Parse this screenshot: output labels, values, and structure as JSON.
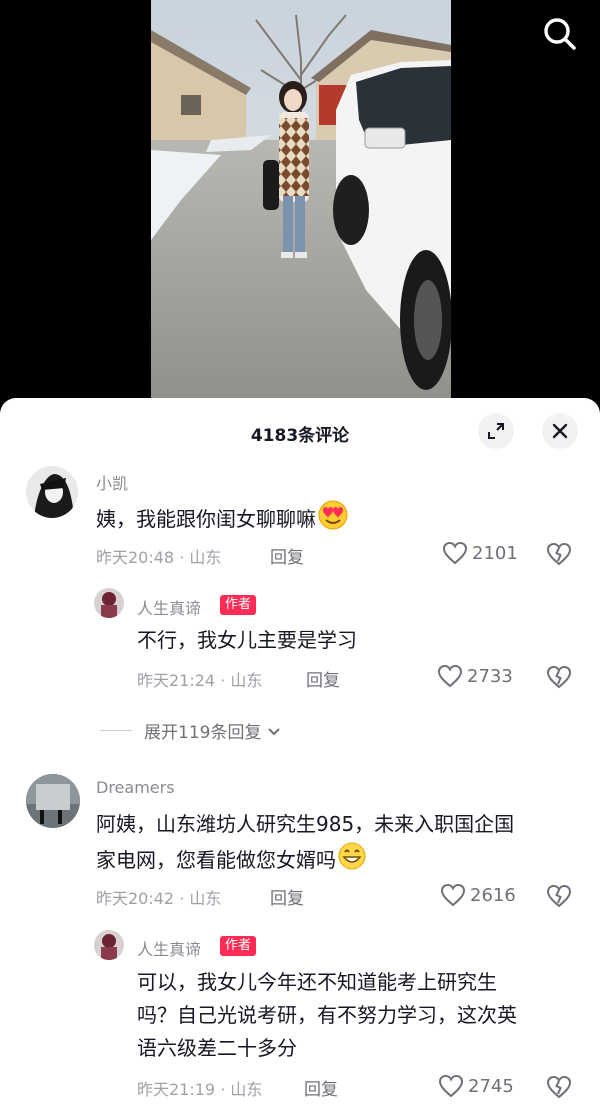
{
  "icons": {
    "search": "search-icon",
    "expand": "expand-icon",
    "close": "close-icon",
    "heart": "heart-outline-icon",
    "dislike": "broken-heart-icon",
    "chevron": "chevron-down-icon",
    "emoji_love": "heart-eyes-emoji",
    "emoji_grin": "grinning-emoji"
  },
  "colors": {
    "author_tag": "#fe2c55",
    "text_primary": "#161823",
    "text_secondary": "#a0a1a7"
  },
  "sheet": {
    "title": "4183条评论"
  },
  "comments": [
    {
      "username": "小凯",
      "content": "姨，我能跟你闺女聊聊嘛",
      "time": "昨天20:48",
      "sep": "·",
      "location": "山东",
      "reply_label": "回复",
      "likes": "2101",
      "reply": {
        "username": "人生真谛",
        "author_label": "作者",
        "content": "不行，我女儿主要是学习",
        "time": "昨天21:24",
        "sep": "·",
        "location": "山东",
        "reply_label": "回复",
        "likes": "2733"
      },
      "expand_label": "展开119条回复"
    },
    {
      "username": "Dreamers",
      "content_line1": "阿姨，山东潍坊人研究生985，未来入职国企国",
      "content_line2": "家电网，您看能做您女婿吗",
      "time": "昨天20:42",
      "sep": "·",
      "location": "山东",
      "reply_label": "回复",
      "likes": "2616",
      "reply": {
        "username": "人生真谛",
        "author_label": "作者",
        "content_line1": "可以，我女儿今年还不知道能考上研究生",
        "content_line2": "吗？自己光说考研，有不努力学习，这次英",
        "content_line3": "语六级差二十多分",
        "time": "昨天21:19",
        "sep": "·",
        "location": "山东",
        "reply_label": "回复",
        "likes": "2745"
      }
    }
  ]
}
